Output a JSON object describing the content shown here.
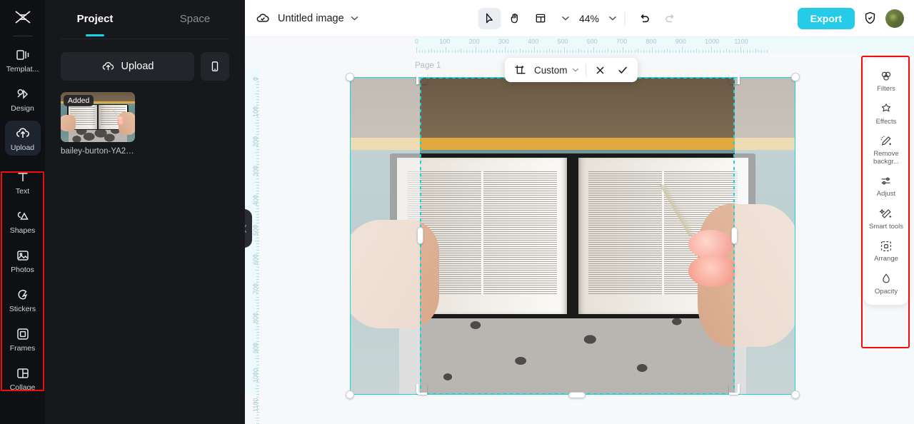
{
  "rail": {
    "logo_name": "capcut-logo",
    "items": [
      {
        "label": "Templat...",
        "icon": "template-icon",
        "active": false
      },
      {
        "label": "Design",
        "icon": "design-icon",
        "active": false
      },
      {
        "label": "Upload",
        "icon": "upload-cloud-icon",
        "active": true
      },
      {
        "label": "Text",
        "icon": "text-icon",
        "active": false
      },
      {
        "label": "Shapes",
        "icon": "shapes-icon",
        "active": false
      },
      {
        "label": "Photos",
        "icon": "photos-icon",
        "active": false
      },
      {
        "label": "Stickers",
        "icon": "stickers-icon",
        "active": false
      },
      {
        "label": "Frames",
        "icon": "frames-icon",
        "active": false
      },
      {
        "label": "Collage",
        "icon": "collage-icon",
        "active": false
      }
    ],
    "highlight_color": "#f40b0b"
  },
  "panel": {
    "tabs": [
      {
        "label": "Project",
        "active": true
      },
      {
        "label": "Space",
        "active": false
      }
    ],
    "upload_label": "Upload",
    "upload_icon": "upload-cloud-icon",
    "phone_icon": "mobile-phone-icon",
    "assets": [
      {
        "badge": "Added",
        "name": "bailey-burton-YA2Ui..."
      }
    ],
    "accent_color": "#18d3e0"
  },
  "topbar": {
    "cloud_icon": "cloud-sync-icon",
    "title": "Untitled image",
    "title_chevron": "chevron-down-icon",
    "tools": [
      {
        "name": "select-tool",
        "icon": "cursor-arrow-icon",
        "selected": true
      },
      {
        "name": "hand-tool",
        "icon": "hand-icon",
        "selected": false
      },
      {
        "name": "layout-tool",
        "icon": "layout-icon",
        "selected": false
      }
    ],
    "layout_chevron": "chevron-down-icon",
    "zoom": "44%",
    "zoom_chevron": "chevron-down-icon",
    "undo_icon": "undo-icon",
    "redo_icon": "redo-icon",
    "export_label": "Export",
    "export_color": "#26cbe8",
    "shield_icon": "shield-check-icon",
    "avatar_name": "user-avatar"
  },
  "canvas": {
    "page_label": "Page 1",
    "selection_color": "#18d3e0",
    "ruler_h_ticks": [
      "0",
      "100",
      "200",
      "300",
      "400",
      "500",
      "600",
      "700",
      "800",
      "900",
      "1000",
      "1100"
    ],
    "ruler_v_ticks": [
      "0",
      "100",
      "200",
      "300",
      "400",
      "500",
      "600",
      "700",
      "800",
      "900",
      "1000",
      "1100"
    ],
    "collapse_icon": "chevron-left-icon"
  },
  "crop_toolbar": {
    "crop_icon": "crop-icon",
    "ratio_label": "Custom",
    "ratio_chevron": "chevron-down-icon",
    "cancel_icon": "close-x-icon",
    "confirm_icon": "check-icon"
  },
  "right_panel": {
    "items": [
      {
        "label": "Filters",
        "icon": "filters-icon"
      },
      {
        "label": "Effects",
        "icon": "effects-sparkle-icon"
      },
      {
        "label": "Remove backgr...",
        "icon": "remove-background-icon"
      },
      {
        "label": "Adjust",
        "icon": "adjust-sliders-icon"
      },
      {
        "label": "Smart tools",
        "icon": "magic-wand-icon"
      },
      {
        "label": "Arrange",
        "icon": "arrange-icon"
      },
      {
        "label": "Opacity",
        "icon": "opacity-drop-icon"
      }
    ],
    "highlight_color": "#f40b0b"
  }
}
